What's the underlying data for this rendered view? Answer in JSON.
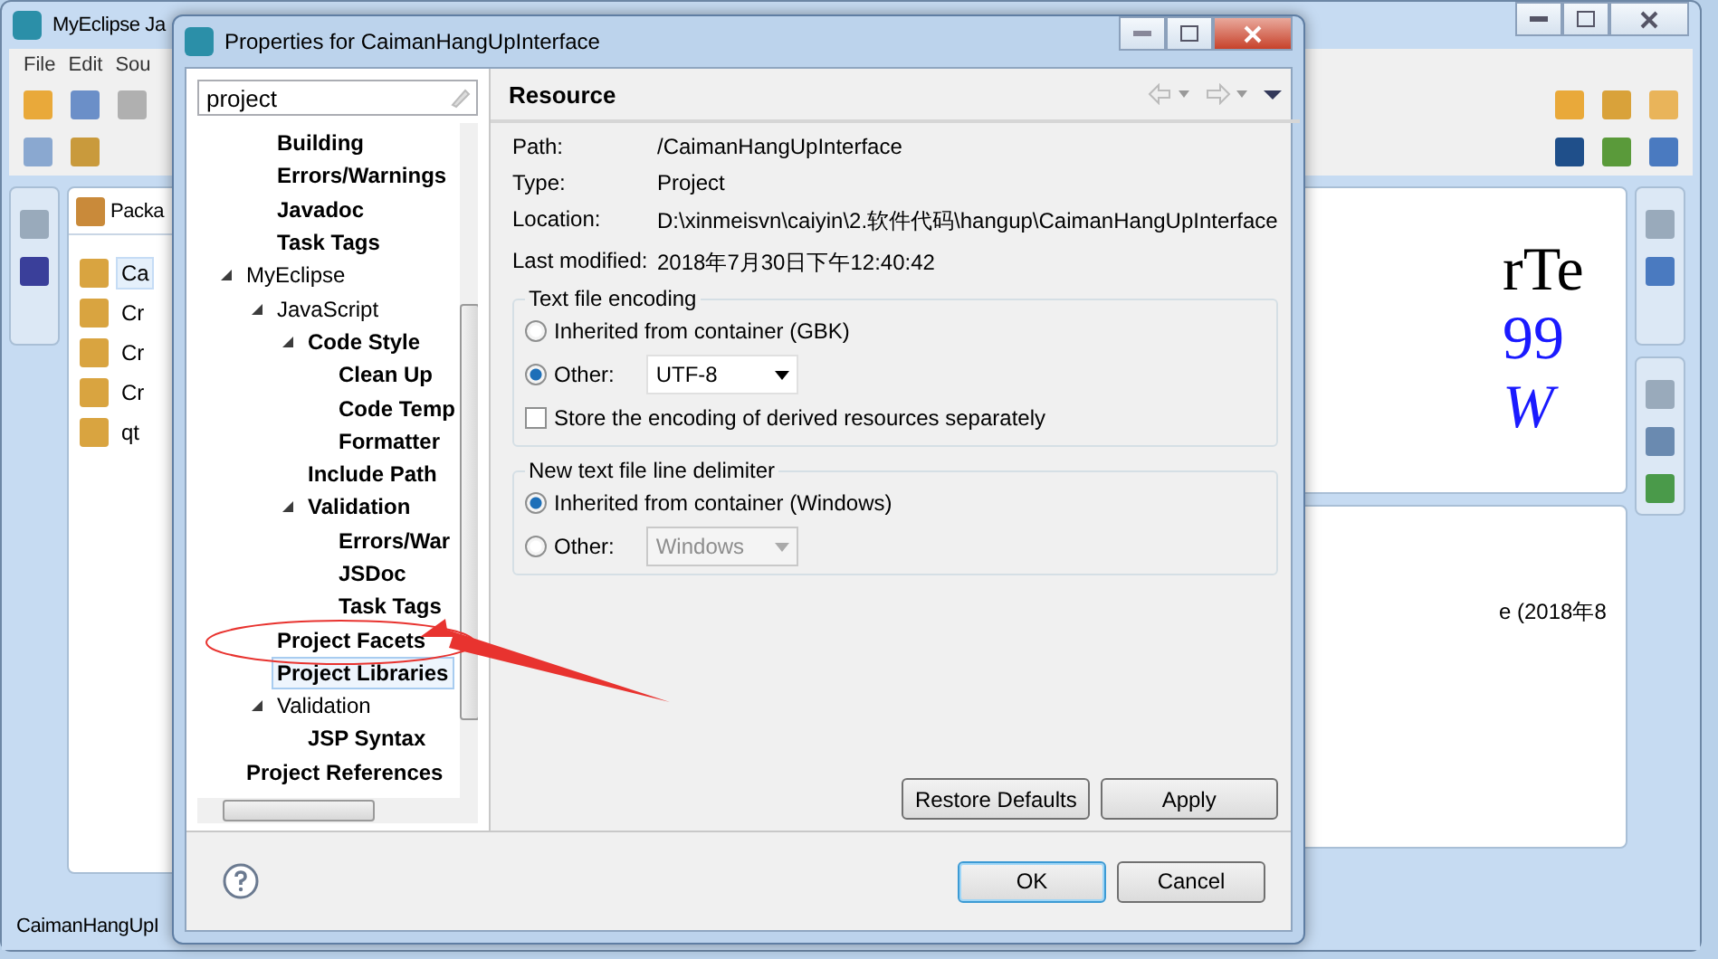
{
  "app_window": {
    "title": "MyEclipse Ja",
    "menu": [
      "File",
      "Edit",
      "Sou"
    ],
    "explorer": {
      "tab": "Packa",
      "items": [
        {
          "label": "Ca",
          "selected": true
        },
        {
          "label": "Cr",
          "selected": false
        },
        {
          "label": "Cr",
          "selected": false
        },
        {
          "label": "Cr",
          "selected": false
        },
        {
          "label": "qt",
          "selected": false
        }
      ]
    },
    "editor_fragments": [
      "rTe",
      "99",
      "W"
    ],
    "history_fragment": "e (2018年8",
    "status_bar": "CaimanHangUpI"
  },
  "dialog": {
    "title": "Properties for CaimanHangUpInterface",
    "filter": {
      "value": "project"
    },
    "tree": {
      "continued_items": [
        {
          "label": "Building",
          "match": true,
          "selected": false
        },
        {
          "label": "Errors/Warnings",
          "match": true,
          "selected": false
        },
        {
          "label": "Javadoc",
          "match": true,
          "selected": false
        },
        {
          "label": "Task Tags",
          "match": true,
          "selected": false
        }
      ],
      "items": [
        {
          "label": "MyEclipse",
          "match": false,
          "selected": false,
          "expanded": true,
          "children": [
            {
              "label": "JavaScript",
              "match": false,
              "selected": false,
              "expanded": true,
              "children": [
                {
                  "label": "Code Style",
                  "match": true,
                  "selected": false,
                  "expanded": true,
                  "children": [
                    {
                      "label": "Clean Up",
                      "match": true,
                      "selected": false
                    },
                    {
                      "label": "Code Temp",
                      "match": true,
                      "selected": false
                    },
                    {
                      "label": "Formatter",
                      "match": true,
                      "selected": false
                    }
                  ]
                },
                {
                  "label": "Include Path",
                  "match": true,
                  "selected": false
                },
                {
                  "label": "Validation",
                  "match": true,
                  "selected": false,
                  "expanded": true,
                  "children": [
                    {
                      "label": "Errors/War",
                      "match": true,
                      "selected": false
                    },
                    {
                      "label": "JSDoc",
                      "match": true,
                      "selected": false
                    },
                    {
                      "label": "Task Tags",
                      "match": true,
                      "selected": false
                    }
                  ]
                }
              ]
            },
            {
              "label": "Project Facets",
              "match": true,
              "selected": false
            },
            {
              "label": "Project Libraries",
              "match": true,
              "selected": true
            },
            {
              "label": "Validation",
              "match": false,
              "selected": false,
              "expanded": true,
              "children": [
                {
                  "label": "JSP Syntax",
                  "match": true,
                  "selected": false
                }
              ]
            }
          ]
        },
        {
          "label": "Project References",
          "match": true,
          "selected": false
        }
      ]
    },
    "page": {
      "title": "Resource",
      "info": [
        {
          "label": "Path:",
          "value": "/CaimanHangUpInterface"
        },
        {
          "label": "Type:",
          "value": "Project"
        },
        {
          "label": "Location:",
          "value": "D:\\xinmeisvn\\caiyin\\2.软件代码\\hangup\\CaimanHangUpInterface"
        },
        {
          "label": "Last modified:",
          "value": "2018年7月30日下午12:40:42"
        }
      ],
      "groups": [
        {
          "title": "Text file encoding",
          "options": [
            {
              "kind": "radio",
              "label": "Inherited from container (GBK)",
              "selected": false
            },
            {
              "kind": "radio",
              "label": "Other:",
              "selected": true,
              "select": {
                "value": "UTF-8",
                "disabled": false
              }
            },
            {
              "kind": "checkbox",
              "label": "Store the encoding of derived resources separately",
              "checked": false
            }
          ]
        },
        {
          "title": "New text file line delimiter",
          "options": [
            {
              "kind": "radio",
              "label": "Inherited from container (Windows)",
              "selected": true
            },
            {
              "kind": "radio",
              "label": "Other:",
              "selected": false,
              "select": {
                "value": "Windows",
                "disabled": true
              }
            }
          ]
        }
      ],
      "buttons": [
        "Restore Defaults",
        "Apply"
      ]
    },
    "footer_buttons": [
      {
        "label": "OK",
        "default": true
      },
      {
        "label": "Cancel",
        "default": false
      }
    ]
  },
  "annotation": {
    "kind": "circle-and-arrow"
  }
}
